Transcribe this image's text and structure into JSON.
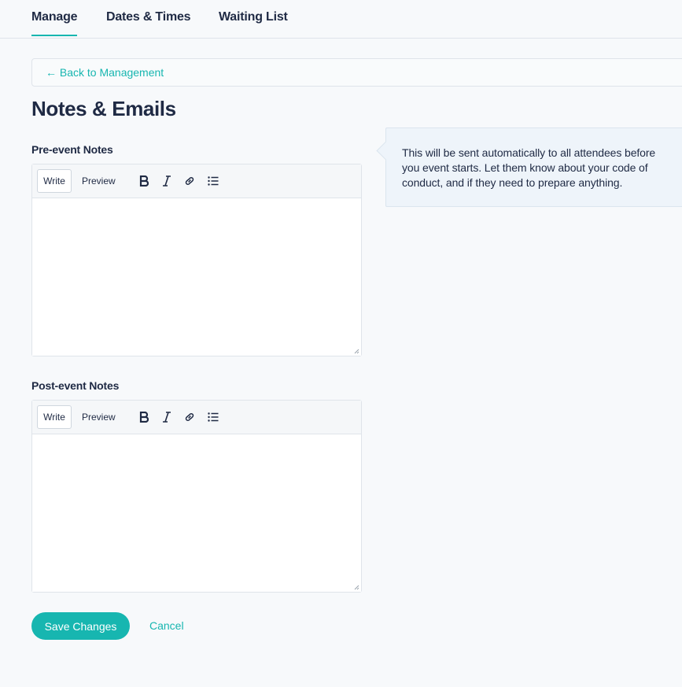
{
  "tabs": [
    {
      "label": "Manage",
      "active": true
    },
    {
      "label": "Dates & Times",
      "active": false
    },
    {
      "label": "Waiting List",
      "active": false
    }
  ],
  "back_link": "← Back to Management",
  "page_title": "Notes & Emails",
  "pre_event": {
    "label": "Pre-event Notes",
    "toolbar": {
      "write": "Write",
      "preview": "Preview"
    },
    "value": ""
  },
  "post_event": {
    "label": "Post-event Notes",
    "toolbar": {
      "write": "Write",
      "preview": "Preview"
    },
    "value": ""
  },
  "toolbar_icons": [
    "bold-icon",
    "italic-icon",
    "link-icon",
    "bulleted-list-icon"
  ],
  "hint": "This will be sent automatically to all attendees before you event starts. Let them know about your code of conduct, and if they need to prepare anything.",
  "actions": {
    "save": "Save Changes",
    "cancel": "Cancel"
  },
  "colors": {
    "accent": "#17b6b0",
    "text": "#1f2a44",
    "background": "#f7f9fb",
    "hint_background": "#eef4fa"
  }
}
